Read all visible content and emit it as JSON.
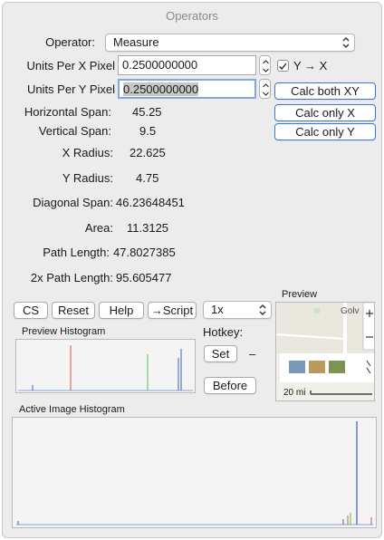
{
  "window": {
    "title": "Operators"
  },
  "operator": {
    "label": "Operator:",
    "value": "Measure"
  },
  "units_x": {
    "label": "Units Per X Pixel",
    "value": "0.2500000000"
  },
  "units_y": {
    "label": "Units Per Y Pixel",
    "value": "0.2500000000"
  },
  "y_to_x": {
    "label": "Y → X",
    "checked": true
  },
  "calc": {
    "both": "Calc both XY",
    "only_x": "Calc only X",
    "only_y": "Calc only Y"
  },
  "measurements": {
    "horizontal_span": {
      "label": "Horizontal Span:",
      "value": "45.25"
    },
    "vertical_span": {
      "label": "Vertical Span:",
      "value": "9.5"
    },
    "x_radius": {
      "label": "X Radius:",
      "value": "22.625"
    },
    "y_radius": {
      "label": "Y Radius:",
      "value": "4.75"
    },
    "diagonal_span": {
      "label": "Diagonal Span:",
      "value": "46.23648451"
    },
    "area": {
      "label": "Area:",
      "value": "11.3125"
    },
    "path_length": {
      "label": "Path Length:",
      "value": "47.8027385"
    },
    "path_length_2x": {
      "label": "2x Path Length:",
      "value": "95.605477"
    }
  },
  "buttons": {
    "cs": "CS",
    "reset": "Reset",
    "help": "Help",
    "script": "→Script"
  },
  "zoom": {
    "value": "1x"
  },
  "hotkey": {
    "label": "Hotkey:",
    "set": "Set",
    "value": "–",
    "before": "Before"
  },
  "preview": {
    "label": "Preview",
    "map_text": "Golv",
    "scale": "20 mi"
  },
  "preview_histogram": {
    "label": "Preview Histogram"
  },
  "active_histogram": {
    "label": "Active Image Histogram"
  },
  "colors": {
    "red": "#d9534f",
    "green": "#58c15a",
    "blue": "#3a5fcd",
    "focus": "#3a78d4"
  }
}
